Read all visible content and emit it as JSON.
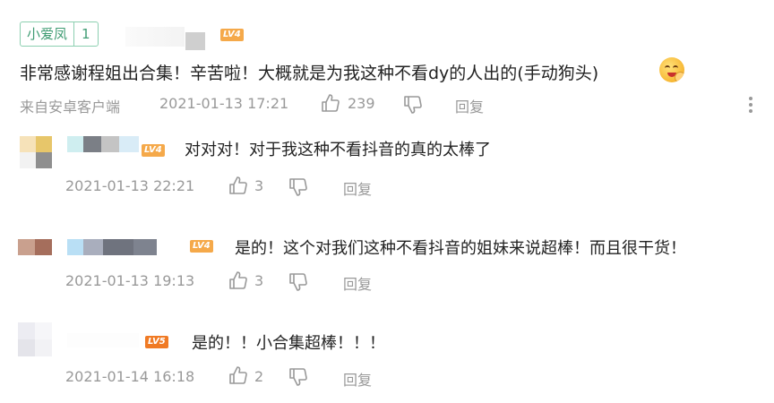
{
  "main_comment": {
    "fan_badge_name": "小爱凤",
    "fan_badge_level": "1",
    "user_level": "LV4",
    "text": "非常感谢程姐出合集！辛苦啦！大概就是为我这种不看dy的人出的(手动狗头)",
    "source": "来自安卓客户端",
    "time": "2021-01-13 17:21",
    "likes": "239",
    "reply_label": "回复",
    "emoji_icon": "dog-head-emoji-icon"
  },
  "replies": [
    {
      "user_level": "LV4",
      "level_color": "#f5a94a",
      "text": "对对对！对于我这种不看抖音的真的太棒了",
      "time": "2021-01-13 22:21",
      "likes": "3",
      "reply_label": "回复"
    },
    {
      "user_level": "LV4",
      "level_color": "#f5a94a",
      "text": "是的！这个对我们这种不看抖音的姐妹来说超棒！而且很干货！",
      "time": "2021-01-13 19:13",
      "likes": "3",
      "reply_label": "回复"
    },
    {
      "user_level": "LV5",
      "level_color": "#f07a24",
      "text": "是的！！小合集超棒！！！",
      "time": "2021-01-14 16:18",
      "likes": "2",
      "reply_label": "回复"
    }
  ],
  "colors": {
    "badge_green": "#3f9c73",
    "level_lv4": "#f5a94a",
    "level_lv5": "#f07a24",
    "meta_gray": "#999999"
  }
}
